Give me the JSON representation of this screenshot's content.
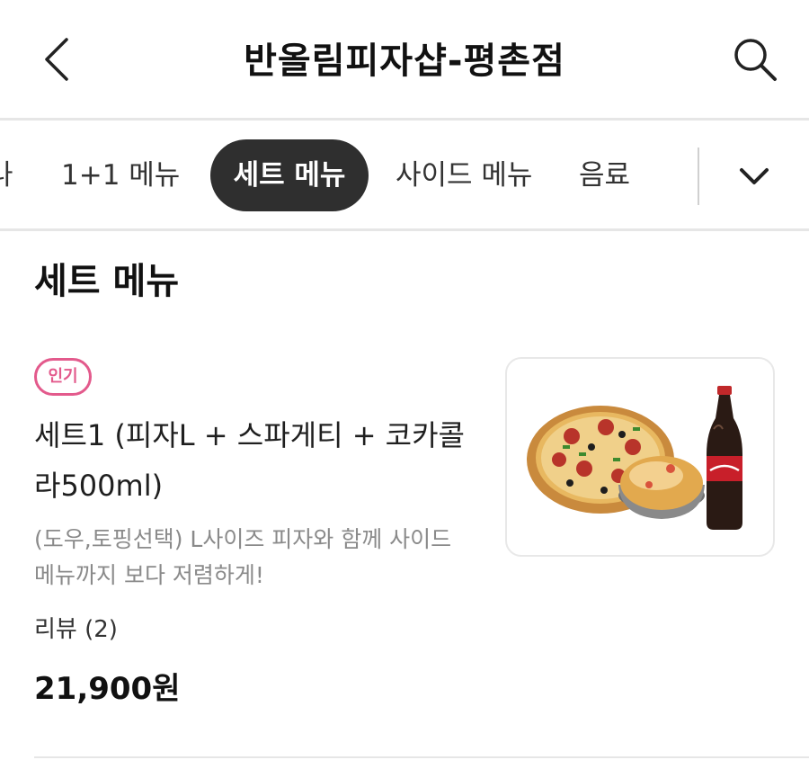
{
  "header": {
    "title": "반올림피자샵-평촌점",
    "back_icon": "chevron-left-icon",
    "search_icon": "search-icon"
  },
  "tabs": {
    "items": [
      {
        "label": "나",
        "active": false
      },
      {
        "label": "1+1 메뉴",
        "active": false
      },
      {
        "label": "세트 메뉴",
        "active": true
      },
      {
        "label": "사이드 메뉴",
        "active": false
      },
      {
        "label": "음료",
        "active": false
      }
    ],
    "expand_icon": "chevron-down-icon"
  },
  "section": {
    "title": "세트 메뉴"
  },
  "menu_item": {
    "badge": "인기",
    "name": "세트1 (피자L + 스파게티 + 코카콜라500ml)",
    "description": "(도우,토핑선택) L사이즈 피자와 함께 사이드 메뉴까지 보다 저렴하게!",
    "reviews": "리뷰 (2)",
    "price": "21,900원",
    "image_icon": "pizza-set-image"
  },
  "colors": {
    "accent_pink": "#e35a8c",
    "active_tab_bg": "#2f2f2f",
    "divider": "#e6e6e6"
  }
}
